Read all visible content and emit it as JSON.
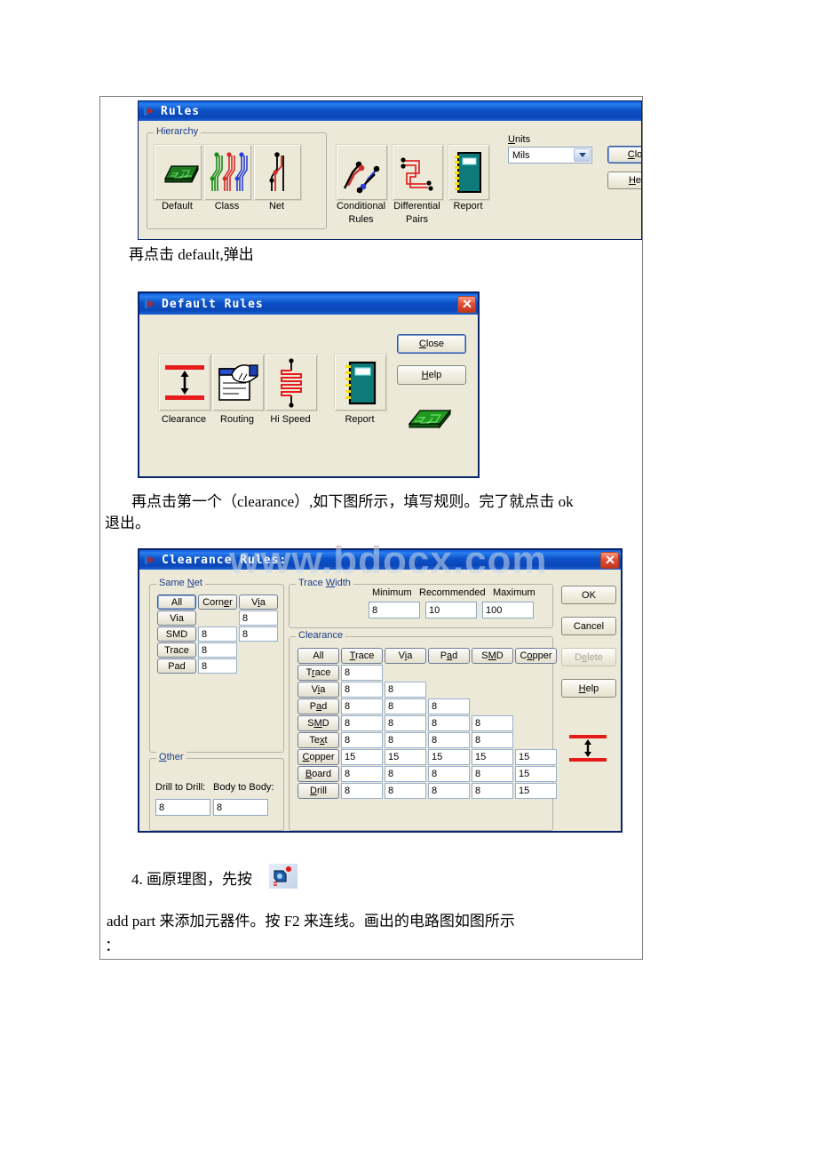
{
  "watermark": "www.bdocx.com",
  "rules_window": {
    "title": "Rules",
    "hierarchy_caption": "Hierarchy",
    "hierarchy_tiles": [
      {
        "label": "Default",
        "icon": "pcb-board-icon"
      },
      {
        "label": "Class",
        "icon": "net-class-icon"
      },
      {
        "label": "Net",
        "icon": "net-icon"
      }
    ],
    "other_tiles": [
      {
        "label": "Conditional\nRules",
        "line1": "Conditional",
        "line2": "Rules",
        "icon": "conditional-rules-icon"
      },
      {
        "label": "Differential\nPairs",
        "line1": "Differential",
        "line2": "Pairs",
        "icon": "differential-pairs-icon"
      },
      {
        "label": "Report",
        "line1": "Report",
        "line2": "",
        "icon": "report-book-icon"
      }
    ],
    "units_label": "Units",
    "units_value": "Mils",
    "units_options": [
      "Mils"
    ],
    "close_label": "Clo",
    "help_label": "He"
  },
  "note1": "再点击 default,弹出",
  "default_rules_window": {
    "title": "Default Rules",
    "tiles": [
      {
        "label": "Clearance",
        "icon": "clearance-icon"
      },
      {
        "label": "Routing",
        "icon": "routing-hand-icon"
      },
      {
        "label": "Hi Speed",
        "icon": "hi-speed-icon"
      },
      {
        "label": "Report",
        "icon": "report-book-icon"
      }
    ],
    "close_label": "Close",
    "help_label": "Help",
    "board_icon": "pcb-board-icon"
  },
  "note2_line1": "再点击第一个（clearance）,如下图所示，填写规则。完了就点击 ok",
  "note2_line2": "退出。",
  "clearance_window": {
    "title": "Clearance Rules:",
    "same_net": {
      "caption_pre": "Same ",
      "caption_u": "N",
      "caption_post": "et",
      "headers": [
        "All",
        "Corner",
        "Via"
      ],
      "rows": [
        {
          "label": "Via",
          "values": [
            "",
            "8"
          ]
        },
        {
          "label": "SMD",
          "values": [
            "8",
            "8"
          ]
        },
        {
          "label": "Trace",
          "values": [
            "8"
          ]
        },
        {
          "label": "Pad",
          "values": [
            "8"
          ]
        }
      ]
    },
    "other": {
      "caption_u": "O",
      "caption_post": "ther",
      "drill_label": "Drill to Drill:",
      "drill_value": "8",
      "body_label": "Body to Body:",
      "body_value": "8"
    },
    "trace_width": {
      "caption_pre": "Trace ",
      "caption_u": "W",
      "caption_post": "idth",
      "col_labels": [
        "Minimum",
        "Recommended",
        "Maximum"
      ],
      "values": [
        "8",
        "10",
        "100"
      ]
    },
    "clearance": {
      "caption": "Clearance",
      "corner_label": "All",
      "headers": [
        "Trace",
        "Via",
        "Pad",
        "SMD",
        "Copper"
      ],
      "header_keys": [
        "T_race",
        "V_ia",
        "P_ad",
        "S_MD",
        "C_opper"
      ],
      "rows": [
        {
          "label": "Trace",
          "values": [
            "8"
          ]
        },
        {
          "label": "Via",
          "values": [
            "8",
            "8"
          ]
        },
        {
          "label": "Pad",
          "values": [
            "8",
            "8",
            "8"
          ]
        },
        {
          "label": "SMD",
          "values": [
            "8",
            "8",
            "8",
            "8"
          ]
        },
        {
          "label": "Text",
          "values": [
            "8",
            "8",
            "8",
            "8"
          ]
        },
        {
          "label": "Copper",
          "values": [
            "15",
            "15",
            "15",
            "15",
            "15"
          ]
        },
        {
          "label": "Board",
          "values": [
            "8",
            "8",
            "8",
            "8",
            "15"
          ]
        },
        {
          "label": "Drill",
          "values": [
            "8",
            "8",
            "8",
            "8",
            "15"
          ]
        }
      ]
    },
    "buttons": {
      "ok": "OK",
      "cancel": "Cancel",
      "delete": "Delete",
      "help": "Help"
    },
    "preview_icon": "clearance-icon"
  },
  "note3_line1_a": "4. 画原理图，先按",
  "note3_icon": "add-part-icon",
  "note3_line2": "add part 来添加元器件。按 F2 来连线。画出的电路图如图所示",
  "note3_line3": "："
}
